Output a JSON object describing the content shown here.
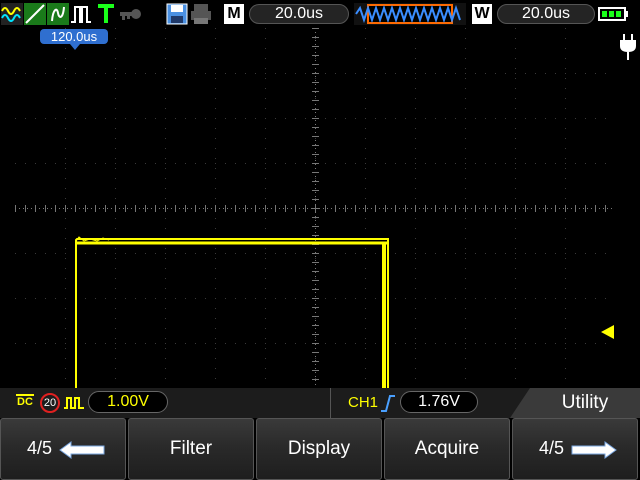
{
  "top_bar": {
    "mode": "M",
    "timebase": "20.0us",
    "window_label": "W",
    "window_timebase": "20.0us",
    "icons": [
      "channel-waveform-icon",
      "ramp-icon",
      "math-icon",
      "pulse-icon",
      "trigger-t-icon",
      "key-icon",
      "save-icon",
      "print-icon",
      "memory-waveform-icon",
      "battery-icon",
      "power-plug-icon"
    ]
  },
  "screen": {
    "trigger_position": "120.0us",
    "trace_color": "#ffff00",
    "grid_color": "#3a3a3a"
  },
  "info_bar": {
    "coupling": "DC",
    "bandwidth_limit": "20",
    "volts_per_div": "1.00V",
    "trigger_source": "CH1",
    "trigger_level": "1.76V",
    "menu_title": "Utility"
  },
  "softkeys": {
    "page_prev": "4/5",
    "filter": "Filter",
    "display": "Display",
    "acquire": "Acquire",
    "page_next": "4/5"
  }
}
